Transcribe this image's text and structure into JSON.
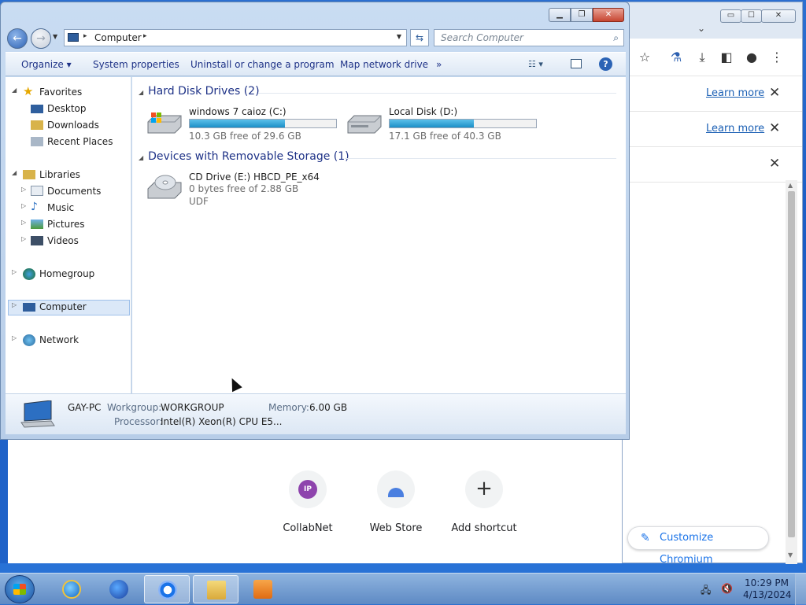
{
  "chromium": {
    "notices": [
      {
        "learn": "Learn more",
        "close": "✕"
      },
      {
        "learn": "Learn more",
        "close": "✕"
      },
      {
        "learn": "",
        "close": "✕"
      }
    ],
    "shortcuts": [
      {
        "label": "CollabNet",
        "badge": "IP"
      },
      {
        "label": "Web Store"
      },
      {
        "label": "Add shortcut",
        "glyph": "+"
      }
    ],
    "customize_label": "Customize Chromium",
    "window_controls": [
      "▭",
      "☐",
      "✕"
    ],
    "toolbar_icons": [
      "star-icon",
      "flask-icon",
      "download-icon",
      "sidepanel-icon",
      "profile-icon",
      "menu-icon"
    ]
  },
  "explorer": {
    "address": {
      "crumb": "Computer",
      "sep": "▸"
    },
    "search_placeholder": "Search Computer",
    "commands": [
      "Organize ▾",
      "System properties",
      "Uninstall or change a program",
      "Map network drive",
      "»"
    ],
    "tree": {
      "favorites": "Favorites",
      "fav_items": [
        "Desktop",
        "Downloads",
        "Recent Places"
      ],
      "libraries": "Libraries",
      "lib_items": [
        "Documents",
        "Music",
        "Pictures",
        "Videos"
      ],
      "homegroup": "Homegroup",
      "computer": "Computer",
      "network": "Network"
    },
    "groups": {
      "hdd": "Hard Disk Drives (2)",
      "removable": "Devices with Removable Storage (1)"
    },
    "drives": [
      {
        "name": "windows 7 caioz (C:)",
        "free": "10.3 GB free of 29.6 GB",
        "used_fraction": 0.65
      },
      {
        "name": "Local Disk (D:)",
        "free": "17.1 GB free of 40.3 GB",
        "used_fraction": 0.576
      }
    ],
    "cd": {
      "name": "CD Drive (E:) HBCD_PE_x64",
      "free": "0 bytes free of 2.88 GB",
      "fs": "UDF"
    },
    "details": {
      "pc_name": "GAY-PC",
      "workgroup_label": "Workgroup:",
      "workgroup": "WORKGROUP",
      "memory_label": "Memory:",
      "memory": "6.00 GB",
      "processor_label": "Processor:",
      "processor": "Intel(R) Xeon(R) CPU E5..."
    }
  },
  "taskbar": {
    "time": "10:29 PM",
    "date": "4/13/2024"
  }
}
